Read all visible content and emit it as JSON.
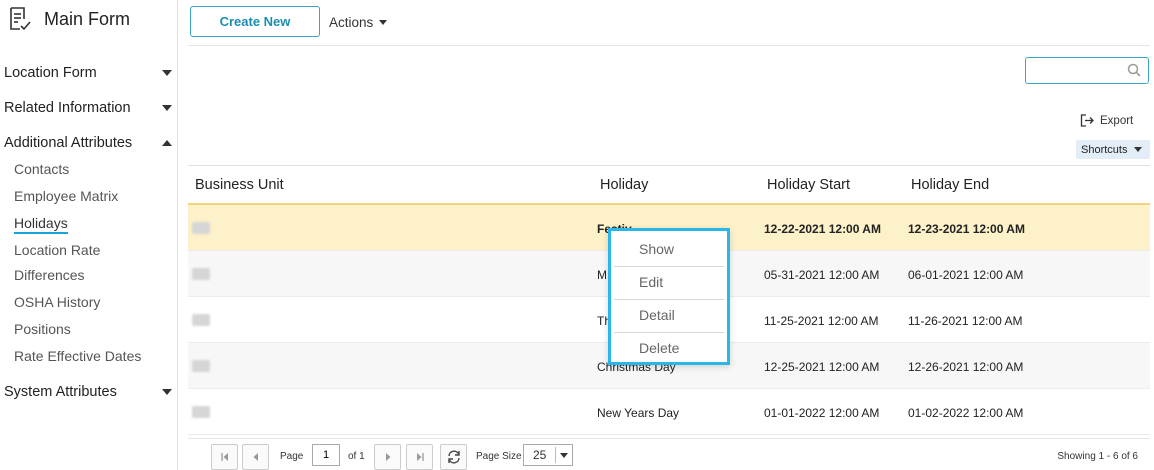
{
  "sidebar": {
    "title": "Main Form",
    "sections": [
      {
        "label": "Location Form",
        "expanded": false
      },
      {
        "label": "Related Information",
        "expanded": false
      },
      {
        "label": "Additional Attributes",
        "expanded": true
      },
      {
        "label": "System Attributes",
        "expanded": false
      }
    ],
    "sub_items": [
      "Contacts",
      "Employee Matrix",
      "Holidays",
      "Location Rate",
      "Differences",
      "OSHA History",
      "Positions",
      "Rate Effective Dates"
    ],
    "active_sub_item": "Holidays"
  },
  "toolbar": {
    "create_label": "Create New",
    "actions_label": "Actions",
    "export_label": "Export",
    "shortcuts_label": "Shortcuts"
  },
  "search": {
    "placeholder": "",
    "value": ""
  },
  "table": {
    "headers": [
      "Business Unit",
      "Holiday",
      "Holiday Start",
      "Holiday End"
    ],
    "rows": [
      {
        "business_unit": "",
        "holiday": "Festiv",
        "start": "12-22-2021 12:00 AM",
        "end": "12-23-2021 12:00 AM",
        "selected": true
      },
      {
        "business_unit": "",
        "holiday": "M",
        "start": "05-31-2021 12:00 AM",
        "end": "06-01-2021 12:00 AM"
      },
      {
        "business_unit": "",
        "holiday": "Th",
        "start": "11-25-2021 12:00 AM",
        "end": "11-26-2021 12:00 AM"
      },
      {
        "business_unit": "",
        "holiday": "Christmas Day",
        "start": "12-25-2021 12:00 AM",
        "end": "12-26-2021 12:00 AM"
      },
      {
        "business_unit": "",
        "holiday": "New Years Day",
        "start": "01-01-2022 12:00 AM",
        "end": "01-02-2022 12:00 AM"
      }
    ]
  },
  "context_menu": {
    "items": [
      "Show",
      "Edit",
      "Detail",
      "Delete"
    ]
  },
  "pager": {
    "page_label": "Page",
    "page_value": "1",
    "of_label": "of 1",
    "page_size_label": "Page Size",
    "page_size_value": "25",
    "showing_text": "Showing 1 - 6 of 6"
  },
  "colors": {
    "accent": "#29b6e8",
    "button_border": "#3aa6c4",
    "selected_row": "#fdf1c9",
    "header_rule": "#f0d37a"
  }
}
